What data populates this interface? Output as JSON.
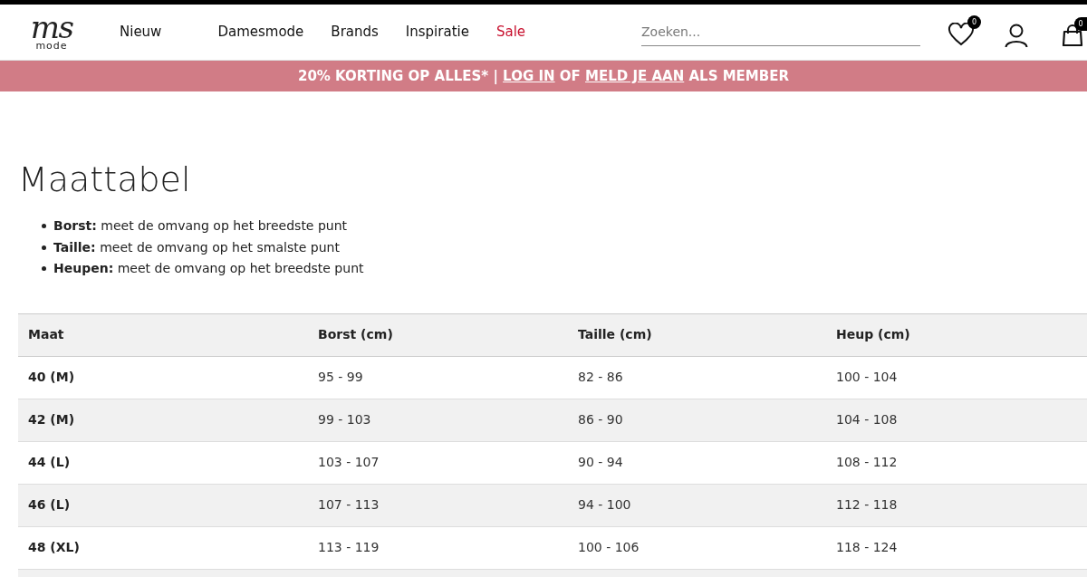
{
  "logo": {
    "mark": "ms",
    "sub": "mode"
  },
  "nav": [
    {
      "label": "Nieuw",
      "sale": false
    },
    {
      "label": "Damesmode",
      "sale": false
    },
    {
      "label": "Brands",
      "sale": false
    },
    {
      "label": "Inspiratie",
      "sale": false
    },
    {
      "label": "Sale",
      "sale": true
    }
  ],
  "search": {
    "placeholder": "Zoeken..."
  },
  "wishlist_count": "0",
  "cart_count": "0",
  "banner": [
    {
      "kind": "text",
      "text": "20% KORTING OP ALLES* | "
    },
    {
      "kind": "link",
      "text": "LOG IN"
    },
    {
      "kind": "text",
      "text": " OF "
    },
    {
      "kind": "link",
      "text": "MELD JE AAN"
    },
    {
      "kind": "text",
      "text": " ALS MEMBER"
    }
  ],
  "title": "Maattabel",
  "bullets": [
    "**Borst:** meet de omvang op het breedste punt",
    "**Taille:** meet de omvang op het smalste punt",
    "**Heupen:** meet de omvang op het breedste punt"
  ],
  "table": {
    "columns": [
      "Maat",
      "Borst (cm)",
      "Taille (cm)",
      "Heup (cm)"
    ],
    "rows": [
      [
        "40 (M)",
        "95 - 99",
        "82 - 86",
        "100 - 104"
      ],
      [
        "42 (M)",
        "99 - 103",
        "86 - 90",
        "104 - 108"
      ],
      [
        "44 (L)",
        "103 - 107",
        "90 - 94",
        "108 - 112"
      ],
      [
        "46 (L)",
        "107 - 113",
        "94 - 100",
        "112 - 118"
      ],
      [
        "48 (XL)",
        "113 - 119",
        "100 - 106",
        "118 - 124"
      ]
    ]
  }
}
